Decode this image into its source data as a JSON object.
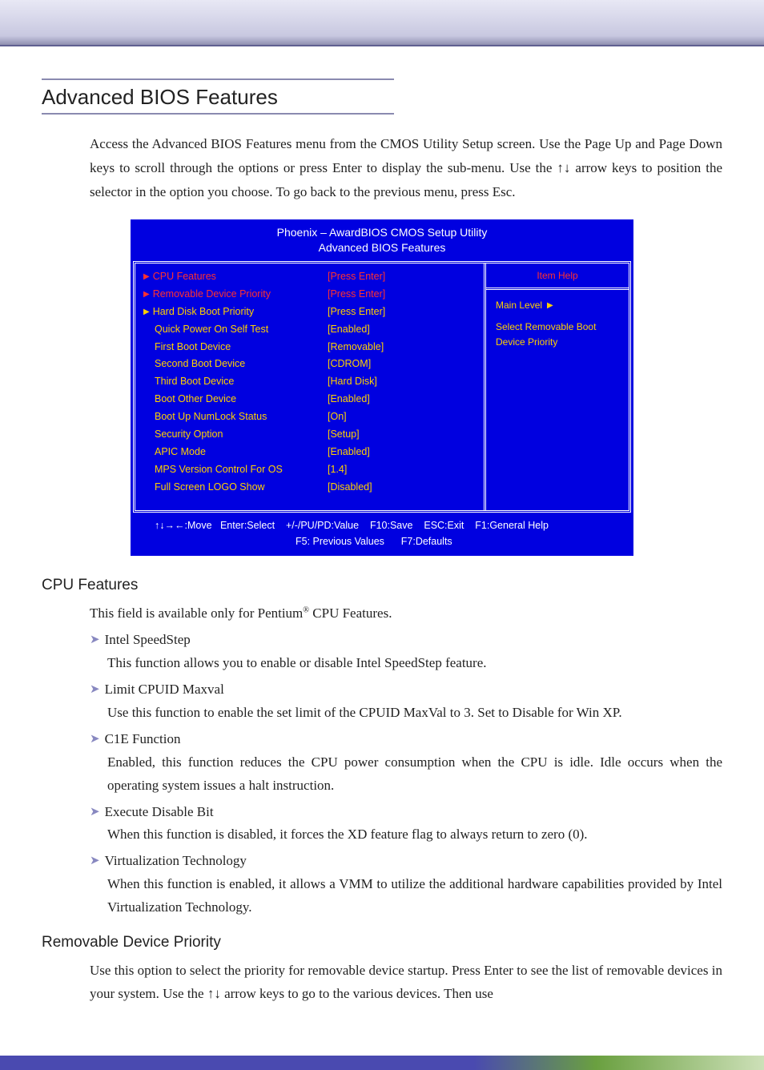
{
  "section_title": "Advanced BIOS Features",
  "intro": "Access the Advanced BIOS Features menu from the CMOS Utility Setup screen. Use the Page Up and Page Down keys to scroll through the options or press Enter to display the sub-menu. Use the ↑↓ arrow keys to position the selector in the option you choose. To go back to the previous menu, press Esc.",
  "bios": {
    "title_line1": "Phoenix – AwardBIOS CMOS Setup Utility",
    "title_line2": "Advanced BIOS Features",
    "help_title": "Item Help",
    "help_main": "Main Level",
    "help_desc": "Select Removable Boot Device Priority",
    "rows": [
      {
        "marker": "red",
        "label": "CPU Features",
        "value": "[Press Enter]",
        "selected": true
      },
      {
        "marker": "red",
        "label": "Removable Device Priority",
        "value": "[Press Enter]",
        "selected": true
      },
      {
        "marker": "yellow",
        "label": "Hard Disk Boot Priority",
        "value": "[Press Enter]",
        "selected": false
      },
      {
        "marker": "",
        "label": "Quick Power On Self Test",
        "value": "[Enabled]",
        "selected": false
      },
      {
        "marker": "",
        "label": "First Boot Device",
        "value": "[Removable]",
        "selected": false
      },
      {
        "marker": "",
        "label": "Second Boot Device",
        "value": "[CDROM]",
        "selected": false
      },
      {
        "marker": "",
        "label": "Third Boot Device",
        "value": "[Hard Disk]",
        "selected": false
      },
      {
        "marker": "",
        "label": "Boot Other Device",
        "value": "[Enabled]",
        "selected": false
      },
      {
        "marker": "",
        "label": "Boot Up NumLock Status",
        "value": "[On]",
        "selected": false
      },
      {
        "marker": "",
        "label": "Security Option",
        "value": "[Setup]",
        "selected": false
      },
      {
        "marker": "",
        "label": "APIC Mode",
        "value": "[Enabled]",
        "selected": false
      },
      {
        "marker": "",
        "label": "MPS Version Control For OS",
        "value": "[1.4]",
        "selected": false
      },
      {
        "marker": "",
        "label": "Full Screen LOGO Show",
        "value": "[Disabled]",
        "selected": false
      }
    ],
    "footer1": "↑↓→←:Move   Enter:Select    +/-/PU/PD:Value    F10:Save    ESC:Exit    F1:General Help",
    "footer2": "F5: Previous Values      F7:Defaults"
  },
  "cpu": {
    "heading": "CPU Features",
    "intro_pre": "This field is available only for Pentium",
    "intro_post": " CPU Features.",
    "items": [
      {
        "label": "Intel SpeedStep",
        "desc": "This function allows you to enable or disable Intel SpeedStep feature."
      },
      {
        "label": "Limit CPUID Maxval",
        "desc": "Use this function to enable the set limit of the CPUID MaxVal to 3. Set to Disable for Win XP."
      },
      {
        "label": "C1E Function",
        "desc": "Enabled, this function reduces the CPU power consumption when the CPU is idle. Idle occurs when the operating system issues a halt instruction."
      },
      {
        "label": "Execute Disable Bit",
        "desc": "When this function is disabled, it forces the XD feature flag to always return to zero (0)."
      },
      {
        "label": "Virtualization Technology",
        "desc": "When this function is enabled, it allows a VMM to utilize the additional hardware capabilities provided by Intel Virtualization Technology."
      }
    ]
  },
  "removable": {
    "heading": "Removable Device Priority",
    "desc": "Use this option to select the priority for removable device startup. Press Enter to see the list of removable devices in your system. Use the ↑↓ arrow keys to go to the various devices. Then use"
  }
}
